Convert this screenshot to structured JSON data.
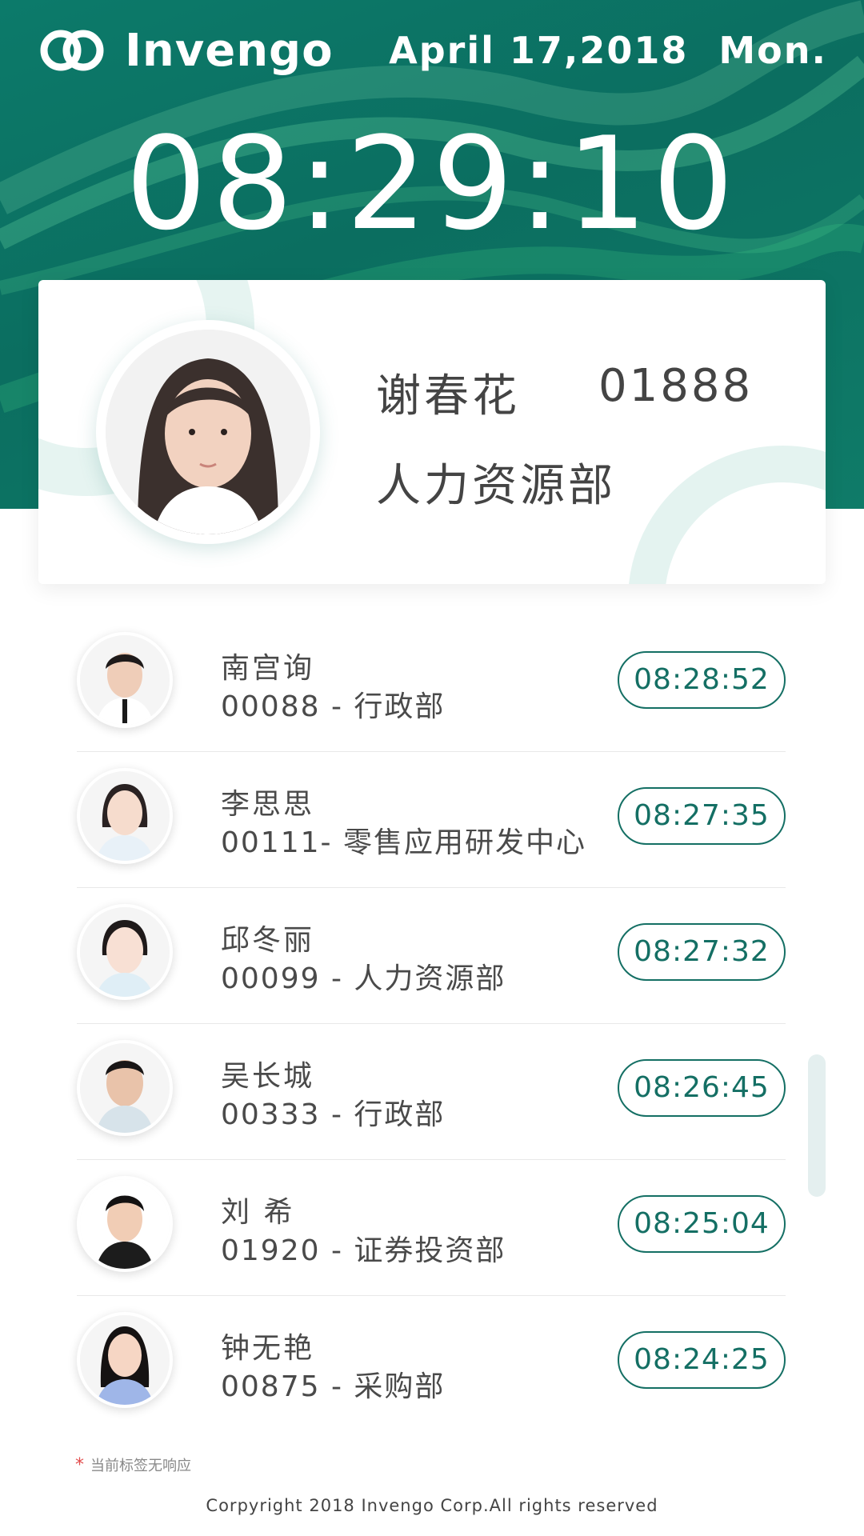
{
  "header": {
    "brand": "Invengo",
    "date": "April 17,2018",
    "weekday": "Mon.",
    "clock": "08:29:10",
    "colors": {
      "primary": "#0b6e60",
      "accent_text": "#146f64"
    }
  },
  "current": {
    "name": "谢春花",
    "id": "01888",
    "department": "人力资源部"
  },
  "records": [
    {
      "name": "南宫询",
      "info": "00088 - 行政部",
      "time": "08:28:52"
    },
    {
      "name": "李思思",
      "info": "00111- 零售应用研发中心",
      "time": "08:27:35"
    },
    {
      "name": "邱冬丽",
      "info": "00099 - 人力资源部",
      "time": "08:27:32"
    },
    {
      "name": "吴长城",
      "info": "00333 - 行政部",
      "time": "08:26:45"
    },
    {
      "name": "刘  希",
      "info": "01920 - 证券投资部",
      "time": "08:25:04"
    },
    {
      "name": "钟无艳",
      "info": "00875 - 采购部",
      "time": "08:24:25"
    }
  ],
  "footer": {
    "note": "当前标签无响应",
    "copyright": "Corpyright 2018 Invengo Corp.All rights reserved"
  }
}
